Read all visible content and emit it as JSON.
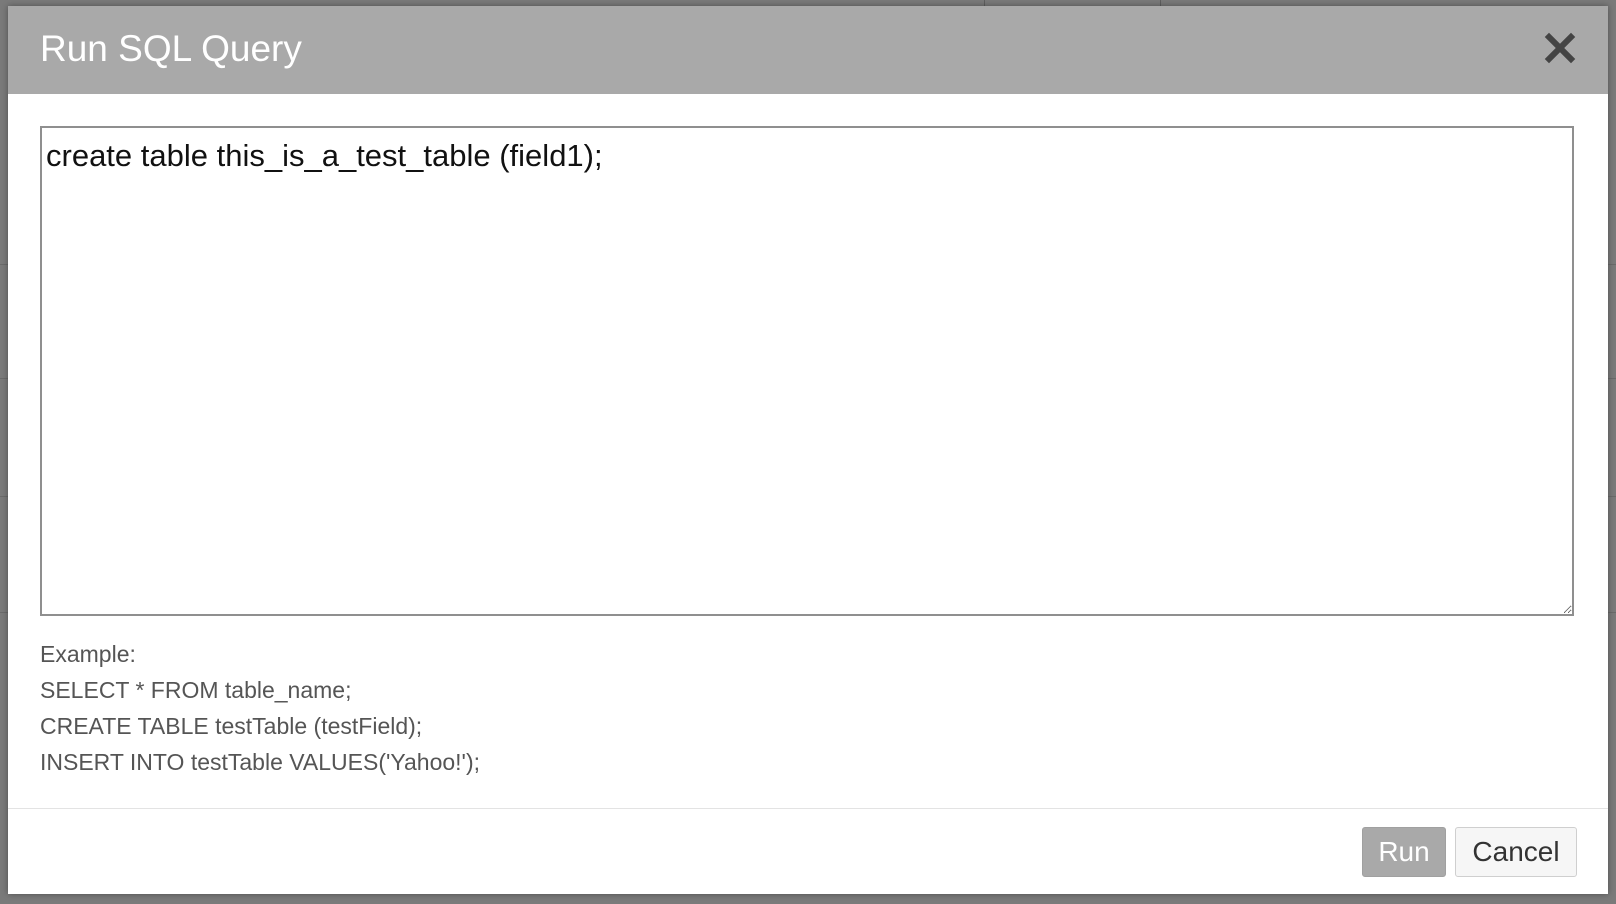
{
  "dialog": {
    "title": "Run SQL Query",
    "close_icon": "close-icon"
  },
  "query": {
    "value": "create table this_is_a_test_table (field1);"
  },
  "examples": {
    "heading": "Example:",
    "lines": [
      "SELECT * FROM table_name;",
      "CREATE TABLE testTable (testField);",
      "INSERT INTO testTable VALUES('Yahoo!');"
    ]
  },
  "footer": {
    "run_label": "Run",
    "cancel_label": "Cancel"
  },
  "colors": {
    "header_bg": "#a9a9a9",
    "run_button_bg": "#a9a9a9",
    "overlay_bg": "#6f6f6f"
  }
}
